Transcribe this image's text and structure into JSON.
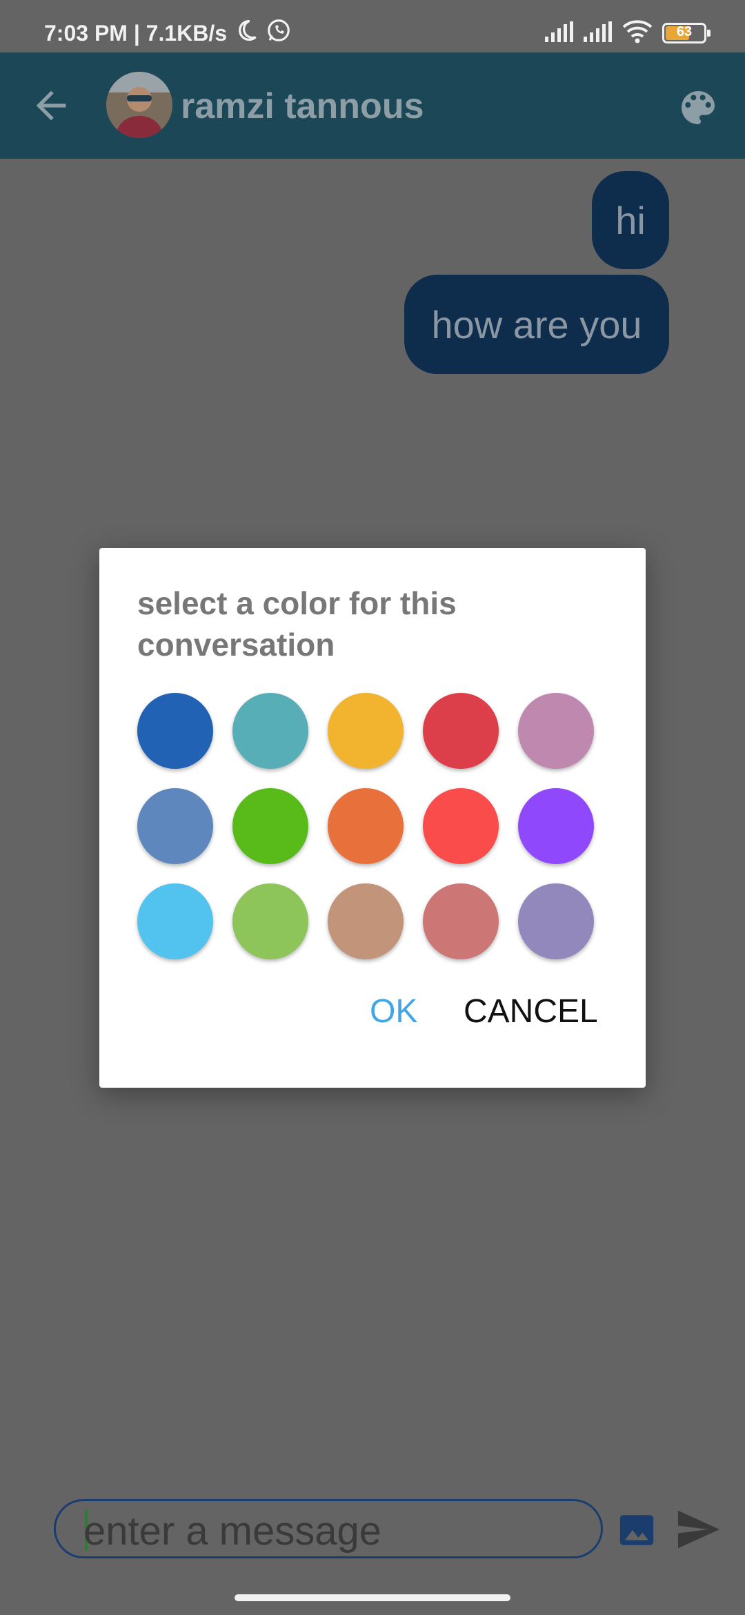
{
  "status_bar": {
    "time_and_speed": "7:03 PM | 7.1KB/s",
    "battery_level": "63",
    "icons": [
      "moon-icon",
      "whatsapp-icon",
      "signal-icon",
      "signal-icon",
      "wifi-icon",
      "battery-icon"
    ]
  },
  "header": {
    "back_icon": "arrow-left-icon",
    "contact_name": "ramzi tannous",
    "palette_icon": "palette-icon"
  },
  "messages": [
    {
      "text": "hi"
    },
    {
      "text": "how are you"
    }
  ],
  "color_dialog": {
    "title": "select a color for this conversation",
    "colors": [
      "#2262b4",
      "#58aeb6",
      "#f2b42e",
      "#dc3f4a",
      "#bf88ae",
      "#5d87bd",
      "#58bb1a",
      "#e8703a",
      "#fa4c4a",
      "#9048fc",
      "#52c3ef",
      "#8ec55a",
      "#c2957b",
      "#cc7675",
      "#9288bc"
    ],
    "ok_label": "OK",
    "cancel_label": "CANCEL"
  },
  "composer": {
    "placeholder": "enter a message",
    "image_icon": "image-icon",
    "send_icon": "send-icon"
  },
  "theme": {
    "appbar": "#1b4756",
    "bubble": "#0e2c4b",
    "ok_color": "#42a5e6",
    "battery_fill": "#e9a636"
  }
}
